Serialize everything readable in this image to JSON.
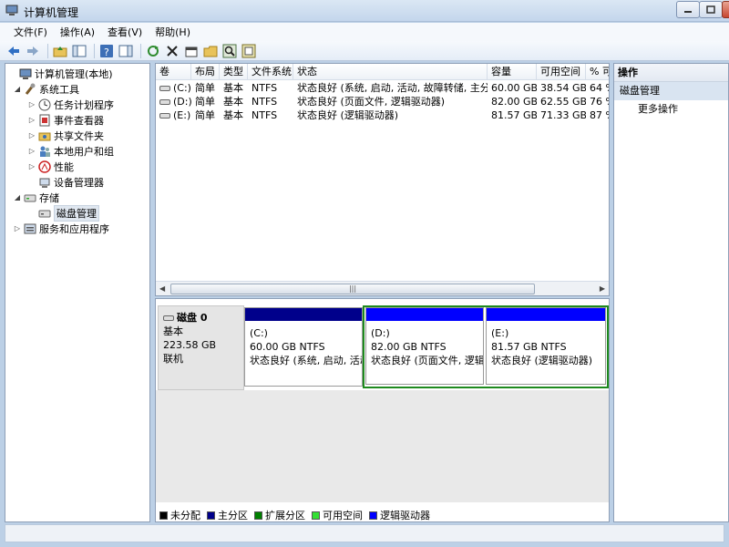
{
  "window": {
    "title": "计算机管理"
  },
  "menu": [
    "文件(F)",
    "操作(A)",
    "查看(V)",
    "帮助(H)"
  ],
  "tree": {
    "root": "计算机管理(本地)",
    "system_tools": "系统工具",
    "task_scheduler": "任务计划程序",
    "event_viewer": "事件查看器",
    "shared_folders": "共享文件夹",
    "local_users": "本地用户和组",
    "performance": "性能",
    "device_manager": "设备管理器",
    "storage": "存储",
    "disk_management": "磁盘管理",
    "services_apps": "服务和应用程序"
  },
  "volumes": {
    "columns": [
      "卷",
      "布局",
      "类型",
      "文件系统",
      "状态",
      "容量",
      "可用空间",
      "% 可"
    ],
    "rows": [
      {
        "vol": "(C:)",
        "layout": "简单",
        "type": "基本",
        "fs": "NTFS",
        "status": "状态良好 (系统, 启动, 活动, 故障转储, 主分区)",
        "capacity": "60.00 GB",
        "free": "38.54 GB",
        "pct": "64 %"
      },
      {
        "vol": "(D:)",
        "layout": "简单",
        "type": "基本",
        "fs": "NTFS",
        "status": "状态良好 (页面文件, 逻辑驱动器)",
        "capacity": "82.00 GB",
        "free": "62.55 GB",
        "pct": "76 %"
      },
      {
        "vol": "(E:)",
        "layout": "简单",
        "type": "基本",
        "fs": "NTFS",
        "status": "状态良好 (逻辑驱动器)",
        "capacity": "81.57 GB",
        "free": "71.33 GB",
        "pct": "87 %"
      }
    ]
  },
  "disk": {
    "name": "磁盘 0",
    "kind": "基本",
    "size": "223.58 GB",
    "state": "联机",
    "partitions": [
      {
        "name": "(C:)",
        "size": "60.00 GB NTFS",
        "status": "状态良好 (系统, 启动, 活动",
        "bar_color": "#00008b"
      },
      {
        "name": "(D:)",
        "size": "82.00 GB NTFS",
        "status": "状态良好 (页面文件, 逻辑",
        "bar_color": "#0000ff"
      },
      {
        "name": "(E:)",
        "size": "81.57 GB NTFS",
        "status": "状态良好 (逻辑驱动器)",
        "bar_color": "#0000ff"
      }
    ]
  },
  "legend": [
    {
      "label": "未分配",
      "color": "#000000"
    },
    {
      "label": "主分区",
      "color": "#00008b"
    },
    {
      "label": "扩展分区",
      "color": "#008000"
    },
    {
      "label": "可用空间",
      "color": "#33e033"
    },
    {
      "label": "逻辑驱动器",
      "color": "#0000ff"
    }
  ],
  "actions": {
    "header": "操作",
    "section": "磁盘管理",
    "more": "更多操作"
  }
}
